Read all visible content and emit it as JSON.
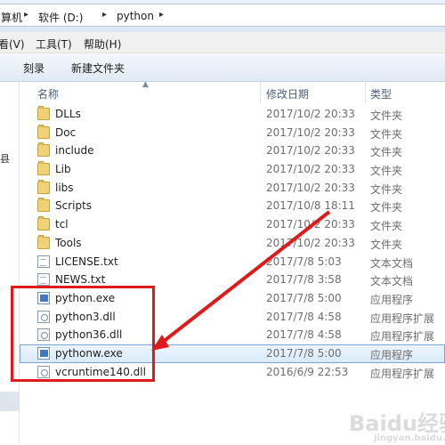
{
  "address": {
    "crumbs": [
      "算机",
      "软件 (D:)",
      "python"
    ]
  },
  "menu": {
    "items": [
      "看(V)",
      "工具(T)",
      "帮助(H)"
    ]
  },
  "commands": {
    "items": [
      "刻录",
      "新建文件夹"
    ]
  },
  "nav": {
    "glyph": "县"
  },
  "columns": {
    "name": "名称",
    "date": "修改日期",
    "type": "类型"
  },
  "files": [
    {
      "name": "DLLs",
      "date": "2017/10/2 20:33",
      "type": "文件夹",
      "icon": "folder-icon"
    },
    {
      "name": "Doc",
      "date": "2017/10/2 20:33",
      "type": "文件夹",
      "icon": "folder-icon"
    },
    {
      "name": "include",
      "date": "2017/10/2 20:33",
      "type": "文件夹",
      "icon": "folder-icon"
    },
    {
      "name": "Lib",
      "date": "2017/10/2 20:33",
      "type": "文件夹",
      "icon": "folder-icon"
    },
    {
      "name": "libs",
      "date": "2017/10/2 20:33",
      "type": "文件夹",
      "icon": "folder-icon"
    },
    {
      "name": "Scripts",
      "date": "2017/10/8 18:11",
      "type": "文件夹",
      "icon": "folder-icon"
    },
    {
      "name": "tcl",
      "date": "2017/10/2 20:33",
      "type": "文件夹",
      "icon": "folder-icon"
    },
    {
      "name": "Tools",
      "date": "2017/10/2 20:33",
      "type": "文件夹",
      "icon": "folder-icon"
    },
    {
      "name": "LICENSE.txt",
      "date": "2017/7/8 5:03",
      "type": "文本文档",
      "icon": "text-file-icon"
    },
    {
      "name": "NEWS.txt",
      "date": "2017/7/8 3:58",
      "type": "文本文档",
      "icon": "text-file-icon"
    },
    {
      "name": "python.exe",
      "date": "2017/7/8 5:00",
      "type": "应用程序",
      "icon": "python-exe-icon"
    },
    {
      "name": "python3.dll",
      "date": "2017/7/8 4:58",
      "type": "应用程序扩展",
      "icon": "dll-file-icon"
    },
    {
      "name": "python36.dll",
      "date": "2017/7/8 4:58",
      "type": "应用程序扩展",
      "icon": "dll-file-icon"
    },
    {
      "name": "pythonw.exe",
      "date": "2017/7/8 5:00",
      "type": "应用程序",
      "icon": "python-exe-icon",
      "selected": true
    },
    {
      "name": "vcruntime140.dll",
      "date": "2016/6/9 22:53",
      "type": "应用程序扩展",
      "icon": "dll-file-icon"
    }
  ],
  "watermark": {
    "text": "Baidu经验",
    "subtext": "jingyan.baidu.com"
  },
  "colors": {
    "highlight_red": "#e01a1a",
    "selection_border": "#7da2ce"
  }
}
